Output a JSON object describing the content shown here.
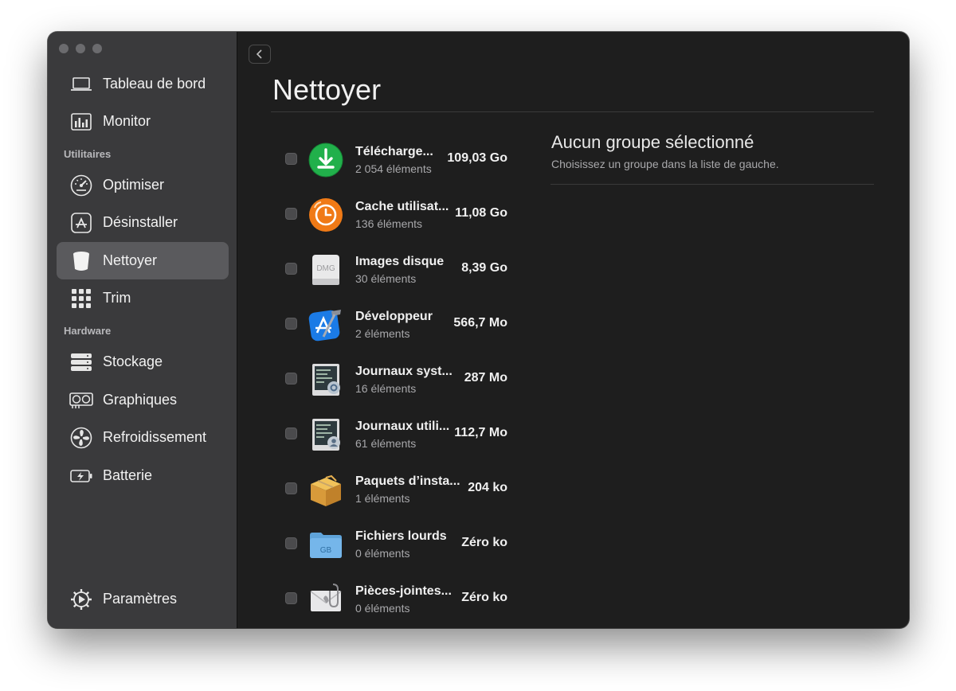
{
  "sidebar": {
    "items_top": [
      {
        "label": "Tableau de bord",
        "icon": "laptop-icon"
      },
      {
        "label": "Monitor",
        "icon": "monitor-chart-icon"
      }
    ],
    "section_utilities": "Utilitaires",
    "items_utilities": [
      {
        "label": "Optimiser",
        "icon": "speedometer-icon"
      },
      {
        "label": "Désinstaller",
        "icon": "app-store-icon"
      },
      {
        "label": "Nettoyer",
        "icon": "bin-icon",
        "active": true
      },
      {
        "label": "Trim",
        "icon": "grid-icon"
      }
    ],
    "section_hardware": "Hardware",
    "items_hardware": [
      {
        "label": "Stockage",
        "icon": "storage-icon"
      },
      {
        "label": "Graphiques",
        "icon": "gpu-icon"
      },
      {
        "label": "Refroidissement",
        "icon": "fan-icon"
      },
      {
        "label": "Batterie",
        "icon": "battery-icon"
      }
    ],
    "settings": {
      "label": "Paramètres",
      "icon": "gear-icon"
    }
  },
  "main": {
    "title": "Nettoyer",
    "groups": [
      {
        "name": "Télécharge...",
        "count": "2 054 éléments",
        "size": "109,03 Go",
        "icon": "download-icon"
      },
      {
        "name": "Cache utilisat...",
        "count": "136 éléments",
        "size": "11,08 Go",
        "icon": "clock-icon"
      },
      {
        "name": "Images disque",
        "count": "30 éléments",
        "size": "8,39 Go",
        "icon": "dmg-icon"
      },
      {
        "name": "Développeur",
        "count": "2 éléments",
        "size": "566,7 Mo",
        "icon": "xcode-icon"
      },
      {
        "name": "Journaux syst...",
        "count": "16 éléments",
        "size": "287 Mo",
        "icon": "system-log-icon"
      },
      {
        "name": "Journaux utili...",
        "count": "61 éléments",
        "size": "112,7 Mo",
        "icon": "user-log-icon"
      },
      {
        "name": "Paquets d’insta...",
        "count": "1 éléments",
        "size": "204 ko",
        "icon": "package-icon"
      },
      {
        "name": "Fichiers lourds",
        "count": "0 éléments",
        "size": "Zéro ko",
        "icon": "folder-icon"
      },
      {
        "name": "Pièces-jointes...",
        "count": "0 éléments",
        "size": "Zéro ko",
        "icon": "mail-attachment-icon"
      }
    ],
    "dmg_badge": "DMG",
    "gb_badge": "GB"
  },
  "detail": {
    "title": "Aucun groupe sélectionné",
    "subtitle": "Choisissez un groupe dans la liste de gauche."
  }
}
